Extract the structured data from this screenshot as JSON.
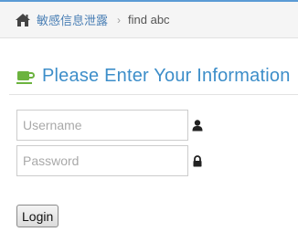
{
  "breadcrumb": {
    "home_icon": "home-icon",
    "link_label": "敏感信息泄露",
    "separator": "›",
    "current": "find abc"
  },
  "header": {
    "icon": "coffee-cup-icon",
    "title": "Please Enter Your Information"
  },
  "form": {
    "username": {
      "placeholder": "Username",
      "value": "",
      "icon": "user-icon"
    },
    "password": {
      "placeholder": "Password",
      "value": "",
      "icon": "lock-icon"
    },
    "submit_label": "Login"
  },
  "colors": {
    "accent_blue": "#3d8ec9",
    "link_blue": "#4a7fb5",
    "cup_green": "#6cb33f",
    "top_border": "#5b9bd5"
  }
}
